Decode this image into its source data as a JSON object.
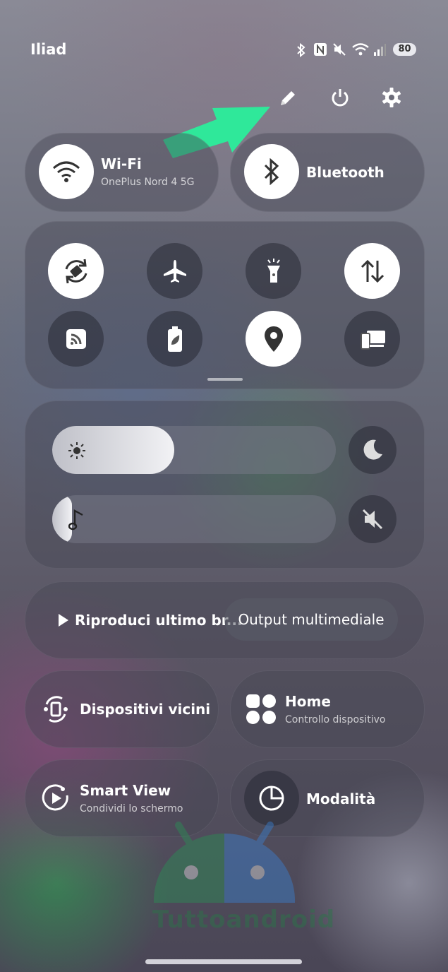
{
  "status_bar": {
    "carrier": "Iliad",
    "battery": "80"
  },
  "header_icons": [
    "edit-icon",
    "power-icon",
    "settings-icon"
  ],
  "tiles": {
    "wifi": {
      "title": "Wi-Fi",
      "subtitle": "OnePlus Nord 4 5G",
      "state": "on"
    },
    "bluetooth": {
      "title": "Bluetooth",
      "state": "on"
    }
  },
  "quick_toggles": [
    {
      "icon": "auto-rotate-icon",
      "state": "on"
    },
    {
      "icon": "airplane-icon",
      "state": "off"
    },
    {
      "icon": "flashlight-icon",
      "state": "off"
    },
    {
      "icon": "mobile-data-icon",
      "state": "on"
    },
    {
      "icon": "nfc-tag-icon",
      "state": "off"
    },
    {
      "icon": "battery-saver-icon",
      "state": "off"
    },
    {
      "icon": "location-icon",
      "state": "on"
    },
    {
      "icon": "device-cast-icon",
      "state": "off"
    }
  ],
  "sliders": {
    "brightness": {
      "icon": "brightness-icon",
      "level": 0.43
    },
    "volume": {
      "icon": "music-note-icon",
      "level": 0.05
    }
  },
  "media": {
    "play_label": "Riproduci ultimo br...",
    "output_label": "Output multimediale"
  },
  "shortcuts": {
    "nearby": {
      "title": "Dispositivi vicini"
    },
    "home": {
      "title": "Home",
      "subtitle": "Controllo dispositivo"
    },
    "smart_view": {
      "title": "Smart View",
      "subtitle": "Condividi lo schermo"
    },
    "modes": {
      "title": "Modalità"
    }
  },
  "watermark": "Tuttoandroid",
  "colors": {
    "arrow": "#2fe89a",
    "tile_on": "#ffffff"
  }
}
